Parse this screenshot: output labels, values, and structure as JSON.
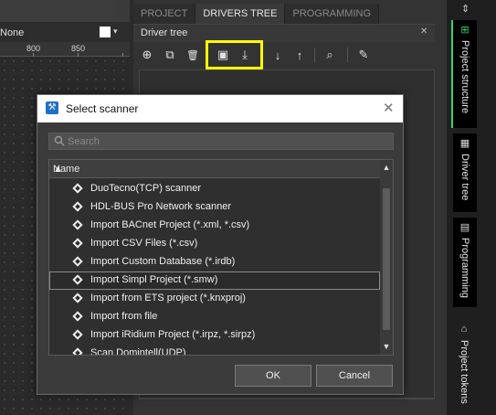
{
  "left": {
    "combo_value": "None",
    "combo_arrow": "▾",
    "ruler_labels": [
      "800",
      "850"
    ]
  },
  "tabs": [
    {
      "label": "PROJECT",
      "active": false
    },
    {
      "label": "DRIVERS TREE",
      "active": true
    },
    {
      "label": "PROGRAMMING",
      "active": false
    }
  ],
  "panel": {
    "title": "Driver tree",
    "close_glyph": "✕"
  },
  "toolbar": {
    "icons": [
      "add-icon",
      "duplicate-icon",
      "delete-icon",
      "add-scanner-icon",
      "import-icon",
      "move-down-icon",
      "move-up-icon",
      "search-icon",
      "clean-icon"
    ],
    "glyphs": {
      "add": "⊕",
      "duplicate": "⧉",
      "delete": "🗑",
      "scanner": "▣",
      "import": "⤓",
      "down": "↓",
      "up": "↑",
      "search": "⌕",
      "clean": "✎"
    },
    "highlight_color": "#ffff00"
  },
  "side_tabs": [
    {
      "label": "Project structure",
      "icon": "project-structure-icon",
      "glyph": "⊞",
      "active": true
    },
    {
      "label": "Driver tree",
      "icon": "driver-tree-icon",
      "glyph": "▦",
      "active": false
    },
    {
      "label": "Programming",
      "icon": "programming-icon",
      "glyph": "▤",
      "active": false
    },
    {
      "label": "Project tokens",
      "icon": "tokens-icon",
      "glyph": "⌂",
      "active": false
    }
  ],
  "side_top_glyph": "⇕",
  "dialog": {
    "title": "Select scanner",
    "app_glyph": "⚒",
    "close_glyph": "✕",
    "search_placeholder": "Search",
    "column_header": "Name",
    "sort_glyph": "▲",
    "scroll_up_glyph": "▲",
    "scroll_down_glyph": "▼",
    "items": [
      {
        "label": "DuoTecno(TCP) scanner",
        "selected": false
      },
      {
        "label": "HDL-BUS Pro Network scanner",
        "selected": false
      },
      {
        "label": "Import BACnet Project (*.xml, *.csv)",
        "selected": false
      },
      {
        "label": "Import CSV Files (*.csv)",
        "selected": false
      },
      {
        "label": "Import Custom Database (*.irdb)",
        "selected": false
      },
      {
        "label": "Import Simpl Project (*.smw)",
        "selected": true
      },
      {
        "label": "Import from ETS project (*.knxproj)",
        "selected": false
      },
      {
        "label": "Import from file",
        "selected": false
      },
      {
        "label": "Import iRidium Project (*.irpz, *.sirpz)",
        "selected": false
      },
      {
        "label": "Scan Domintell(UDP)",
        "selected": false
      }
    ],
    "ok_label": "OK",
    "cancel_label": "Cancel"
  },
  "colors": {
    "accent_green": "#3bd16f",
    "highlight_yellow": "#ffff00",
    "dialog_bg": "#3b3b3b"
  }
}
